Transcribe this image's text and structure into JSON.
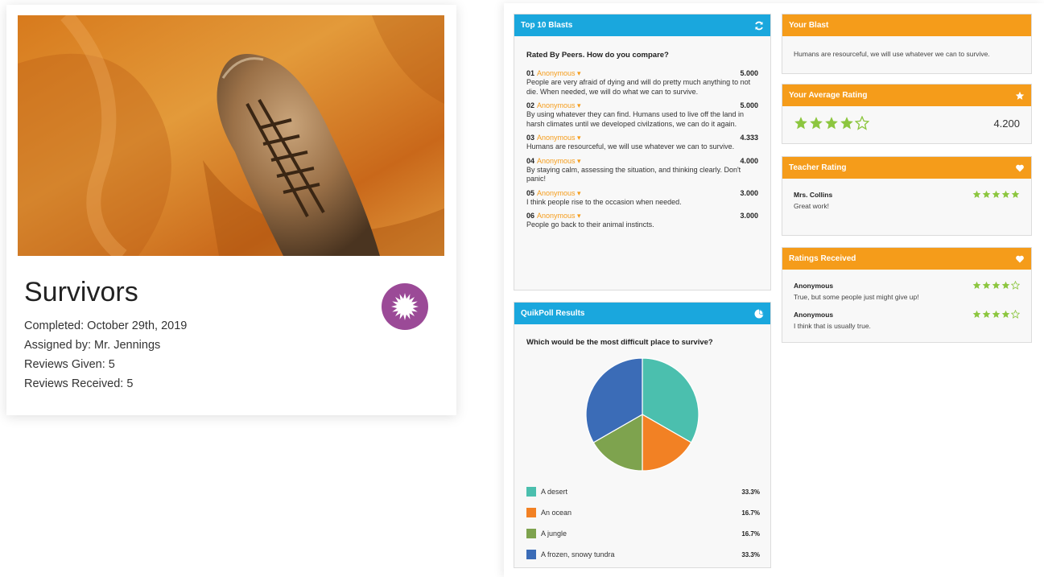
{
  "assignment": {
    "title": "Survivors",
    "completed": "Completed: October 29th, 2019",
    "assigned_by": "Assigned by: Mr. Jennings",
    "reviews_given": "Reviews Given: 5",
    "reviews_received": "Reviews Received: 5",
    "badge_icon": "starburst-icon"
  },
  "top_blasts": {
    "title": "Top 10 Blasts",
    "refresh_icon": "refresh-icon",
    "intro": "Rated By Peers. How do you compare?",
    "items": [
      {
        "num": "01",
        "author": "Anonymous ▾",
        "score": "5.000",
        "text": "People are very afraid of dying and will do pretty much anything to not die. When needed, we will do what we can to survive."
      },
      {
        "num": "02",
        "author": "Anonymous ▾",
        "score": "5.000",
        "text": "By using whatever they can find. Humans used to live off the land in harsh climates until we developed civilzations, we can do it again."
      },
      {
        "num": "03",
        "author": "Anonymous ▾",
        "score": "4.333",
        "text": "Humans are resourceful, we will use whatever we can to survive."
      },
      {
        "num": "04",
        "author": "Anonymous ▾",
        "score": "4.000",
        "text": "By staying calm, assessing the situation, and thinking clearly. Don't panic!"
      },
      {
        "num": "05",
        "author": "Anonymous ▾",
        "score": "3.000",
        "text": "I think people rise to the occasion when needed."
      },
      {
        "num": "06",
        "author": "Anonymous ▾",
        "score": "3.000",
        "text": "People go back to their animal instincts."
      }
    ]
  },
  "poll": {
    "title": "QuikPoll Results",
    "icon": "pie-chart-icon",
    "question": "Which would be the most difficult place to survive?",
    "options": [
      {
        "label": "A desert",
        "pct": "33.3%",
        "value": 33.3,
        "color": "#4bbfae"
      },
      {
        "label": "An ocean",
        "pct": "16.7%",
        "value": 16.7,
        "color": "#f28124"
      },
      {
        "label": "A jungle",
        "pct": "16.7%",
        "value": 16.7,
        "color": "#7ea34e"
      },
      {
        "label": "A frozen, snowy tundra",
        "pct": "33.3%",
        "value": 33.3,
        "color": "#3b6cb7"
      }
    ]
  },
  "your_blast": {
    "title": "Your Blast",
    "text": "Humans are resourceful, we will use whatever we can to survive."
  },
  "average_rating": {
    "title": "Your Average Rating",
    "icon": "star-icon",
    "value": "4.200",
    "stars": 4
  },
  "teacher_rating": {
    "title": "Teacher Rating",
    "icon": "heart-icon",
    "rater": "Mrs. Collins",
    "comment": "Great work!",
    "stars": 5
  },
  "ratings_received": {
    "title": "Ratings Received",
    "icon": "heart-icon",
    "items": [
      {
        "rater": "Anonymous",
        "comment": "True, but some people just might give up!",
        "stars": 4
      },
      {
        "rater": "Anonymous",
        "comment": "I think that is usually true.",
        "stars": 4
      }
    ]
  },
  "colors": {
    "blue_header": "#1aa7dd",
    "orange_header": "#f59c1a",
    "star_green": "#8cc63f",
    "badge_purple": "#9b4a97"
  }
}
